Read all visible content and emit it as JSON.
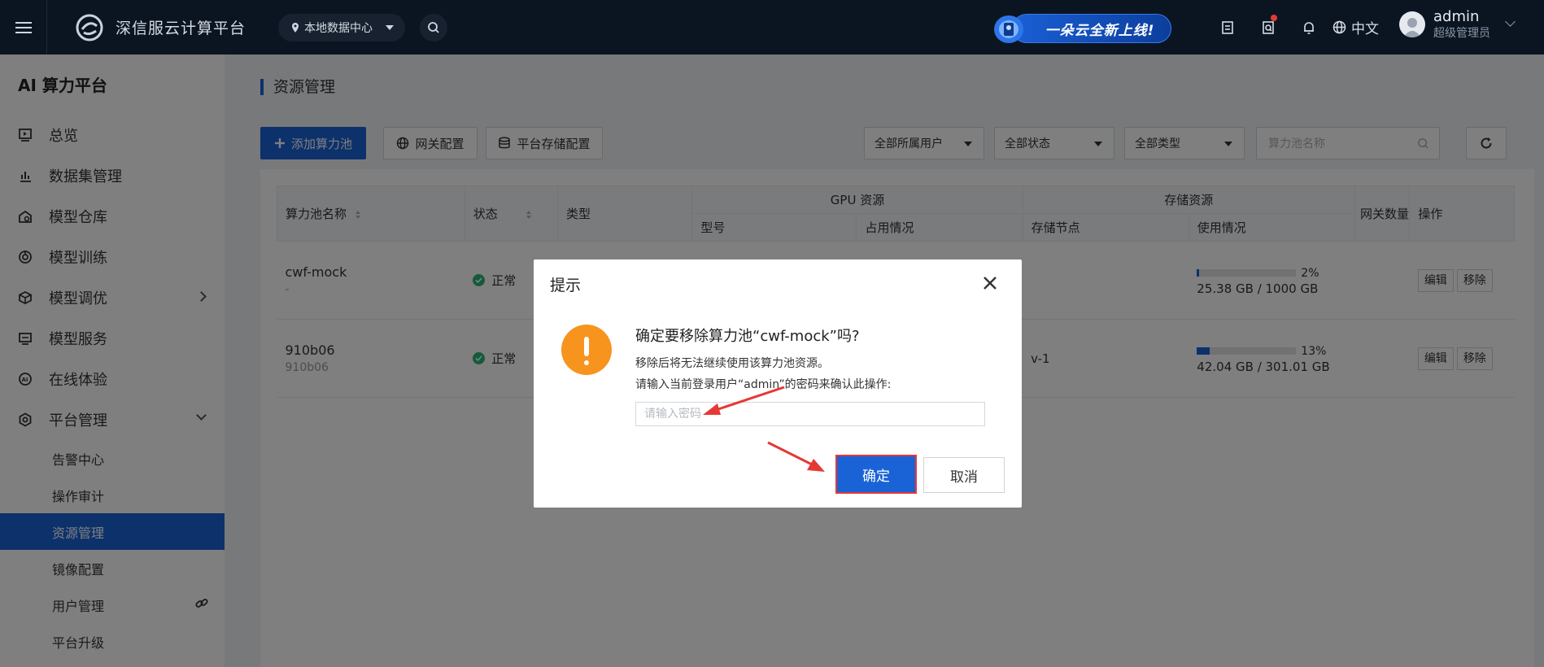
{
  "app": {
    "name": "深信服云计算平台",
    "datacenter": "本地数据中心",
    "banner": "一朵云全新上线!",
    "language": "中文",
    "user": {
      "name": "admin",
      "role": "超级管理员"
    }
  },
  "sidebar": {
    "title": "AI 算力平台",
    "items": [
      {
        "label": "总览"
      },
      {
        "label": "数据集管理"
      },
      {
        "label": "模型仓库"
      },
      {
        "label": "模型训练"
      },
      {
        "label": "模型调优"
      },
      {
        "label": "模型服务"
      },
      {
        "label": "在线体验"
      },
      {
        "label": "平台管理"
      }
    ],
    "sub_items": [
      {
        "label": "告警中心"
      },
      {
        "label": "操作审计"
      },
      {
        "label": "资源管理"
      },
      {
        "label": "镜像配置"
      },
      {
        "label": "用户管理"
      },
      {
        "label": "平台升级"
      }
    ]
  },
  "page": {
    "title": "资源管理",
    "add_button": "添加算力池",
    "gateway_button": "网关配置",
    "storage_button": "平台存储配置",
    "filter_user": "全部所属用户",
    "filter_status": "全部状态",
    "filter_type": "全部类型",
    "search_placeholder": "算力池名称"
  },
  "table": {
    "headers": {
      "name": "算力池名称",
      "status": "状态",
      "type": "类型",
      "gpu_group": "GPU 资源",
      "gpu_model": "型号",
      "gpu_usage": "占用情况",
      "storage_group": "存储资源",
      "storage_node": "存储节点",
      "storage_usage": "使用情况",
      "gateway_count": "网关数量",
      "actions": "操作"
    },
    "rows": [
      {
        "name": "cwf-mock",
        "sub": "-",
        "status": "正常",
        "storage_node": "",
        "usage_pct": "2%",
        "usage_value": 2,
        "usage_size": "25.38 GB / 1000 GB",
        "edit": "编辑",
        "remove": "移除"
      },
      {
        "name": "910b06",
        "sub": "910b06",
        "status": "正常",
        "storage_node": "v-1",
        "usage_pct": "13%",
        "usage_value": 13,
        "usage_size": "42.04 GB / 301.01 GB",
        "edit": "编辑",
        "remove": "移除"
      }
    ]
  },
  "modal": {
    "title": "提示",
    "heading": "确定要移除算力池“cwf-mock”吗?",
    "line1": "移除后将无法继续使用该算力池资源。",
    "line2": "请输入当前登录用户“admin”的密码来确认此操作:",
    "password_placeholder": "请输入密码",
    "password_value": "",
    "confirm": "确定",
    "cancel": "取消"
  },
  "colors": {
    "primary": "#1a63d6",
    "topbar": "#0b1522",
    "warning": "#f7941d",
    "success": "#2bb673",
    "highlight": "#e53935"
  }
}
